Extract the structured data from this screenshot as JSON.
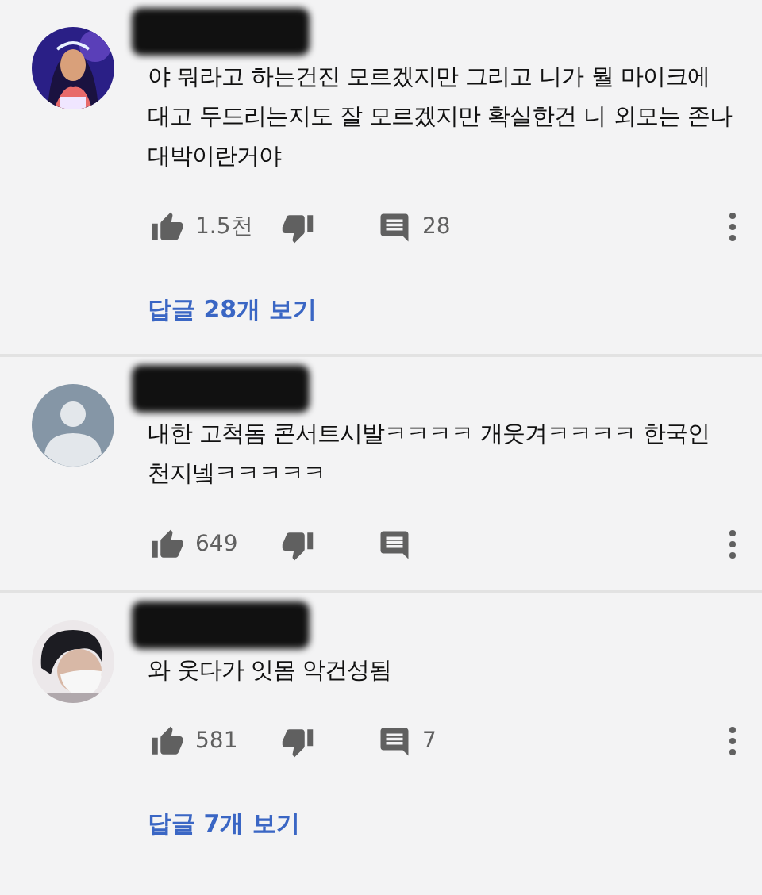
{
  "comments": [
    {
      "text": "야 뭐라고 하는건진 모르겠지만 그리고 니가 뭘 마이크에 대고 두드리는지도 잘 모르겠지만 확실한건 니 외모는 존나 대박이란거야",
      "likes": "1.5천",
      "reply_count": "28",
      "replies_link": "답글 28개 보기"
    },
    {
      "avatar": {
        "kind": "default"
      },
      "text": "내한 고척돔 콘서트시발ㅋㅋㅋㅋ 개웃겨ㅋㅋㅋㅋ 한국인 천지넼ㅋㅋㅋㅋㅋ",
      "likes": "649"
    },
    {
      "text": "와 웃다가 잇몸 악건성됨",
      "likes": "581",
      "reply_count": "7",
      "replies_link": "답글 7개 보기"
    }
  ]
}
